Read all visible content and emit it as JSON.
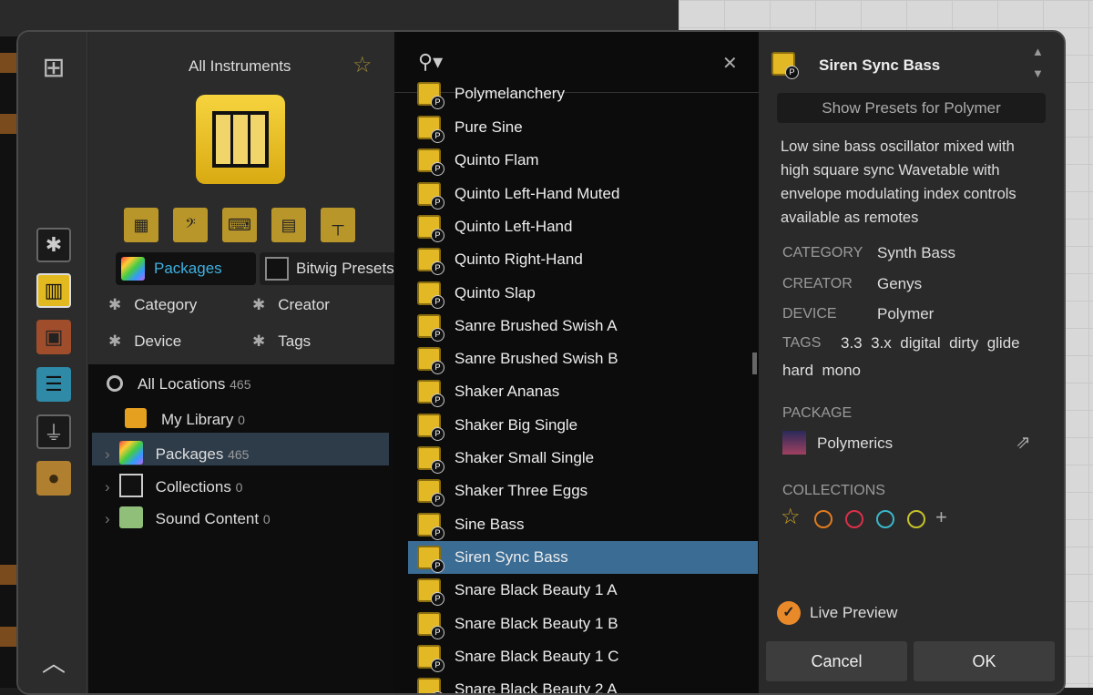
{
  "left": {
    "title": "All Instruments",
    "filters": [
      {
        "label": "Packages",
        "active": true
      },
      {
        "label": "Bitwig Presets"
      }
    ],
    "facets": [
      "Category",
      "Creator",
      "Device",
      "Tags"
    ],
    "locations": [
      {
        "label": "All Locations",
        "count": "465"
      },
      {
        "label": "My Library",
        "count": "0"
      },
      {
        "label": "Packages",
        "count": "465",
        "selected": true
      },
      {
        "label": "Collections",
        "count": "0"
      },
      {
        "label": "Sound Content",
        "count": "0"
      }
    ]
  },
  "list": {
    "partial_top": "Polymelanchery",
    "items": [
      "Pure Sine",
      "Quinto Flam",
      "Quinto Left-Hand Muted",
      "Quinto Left-Hand",
      "Quinto Right-Hand",
      "Quinto Slap",
      "Sanre Brushed Swish A",
      "Sanre Brushed Swish B",
      "Shaker Ananas",
      "Shaker Big Single",
      "Shaker Small Single",
      "Shaker Three Eggs",
      "Sine Bass",
      "Siren Sync Bass",
      "Snare Black Beauty 1 A",
      "Snare Black Beauty 1 B",
      "Snare Black Beauty 1 C"
    ],
    "selected": "Siren Sync Bass",
    "partial_bottom": "Snare Black Beauty 2 A",
    "selected_color": "#3b6c94"
  },
  "detail": {
    "title": "Siren Sync Bass",
    "show_presets": "Show Presets for Polymer",
    "description": "Low sine bass oscillator mixed with high square sync Wavetable with envelope modulating index controls available as remotes",
    "category_label": "CATEGORY",
    "category": "Synth Bass",
    "creator_label": "CREATOR",
    "creator": "Genys",
    "device_label": "DEVICE",
    "device": "Polymer",
    "tags_label": "TAGS",
    "tags": [
      "3.3",
      "3.x",
      "digital",
      "dirty",
      "glide",
      "hard",
      "mono"
    ],
    "package_label": "PACKAGE",
    "package": "Polymerics",
    "collections_label": "COLLECTIONS",
    "collection_colors": [
      "#c9a227",
      "#e07a1f",
      "#d9304a",
      "#3ab6c9",
      "#c6c22a"
    ],
    "add": "+",
    "live_preview": "Live Preview",
    "cancel": "Cancel",
    "ok": "OK"
  }
}
